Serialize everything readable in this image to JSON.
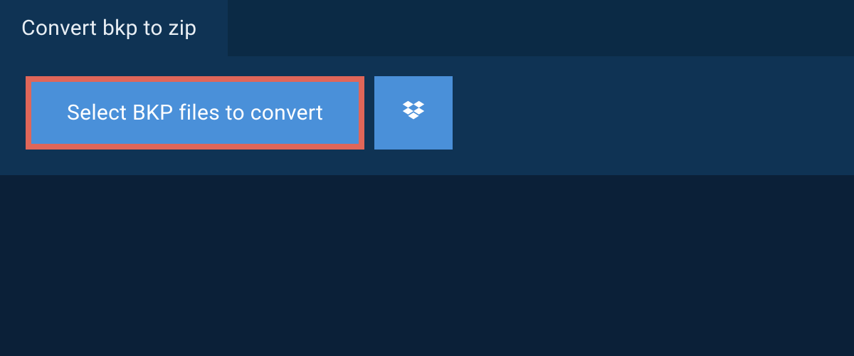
{
  "tab": {
    "title": "Convert bkp to zip"
  },
  "actions": {
    "select_label": "Select BKP files to convert"
  },
  "colors": {
    "background": "#0b2038",
    "tab_bar": "#0b2a45",
    "panel": "#0f3354",
    "button": "#4a90d9",
    "highlight_border": "#e06659",
    "text": "#ffffff"
  }
}
